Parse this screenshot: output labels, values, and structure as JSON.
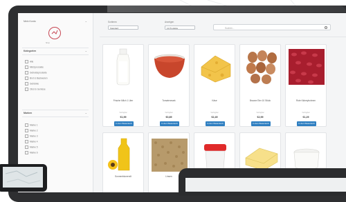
{
  "sidebar": {
    "account_label": "Mein Konto",
    "logo_caption": "Shop",
    "categories_title": "Kategorien",
    "categories": [
      "Alle",
      "Milchprodukte",
      "Getreideprodukte",
      "Brot & Backwaren",
      "Getränke",
      "Obst & Gemüse"
    ],
    "brands_title": "Marken",
    "brands": [
      "Marke 1",
      "Marke 2",
      "Marke 3",
      "Marke 4",
      "Marke 5",
      "Marke 6"
    ]
  },
  "toolbar": {
    "sort_label": "Sortieren",
    "sort_value": "Standard",
    "show_label": "Anzeigen",
    "show_value": "12 Produkte",
    "search_placeholder": "Suchen..."
  },
  "products": [
    {
      "name": "Frische Milch 1 Liter",
      "meta": "Verfügbar",
      "price": "€1,99",
      "button": "In den Warenkorb"
    },
    {
      "name": "Tomatenmark",
      "meta": "Verfügbar",
      "price": "€0,89",
      "button": "In den Warenkorb"
    },
    {
      "name": "Käse",
      "meta": "Verfügbar",
      "price": "€2,49",
      "button": "In den Warenkorb"
    },
    {
      "name": "Braune Eier 10 Stück",
      "meta": "Verfügbar",
      "price": "€2,99",
      "button": "In den Warenkorb"
    },
    {
      "name": "Rote Kidneybohnen",
      "meta": "Verfügbar",
      "price": "€1,29",
      "button": "In den Warenkorb"
    },
    {
      "name": "Sonnenblumenöl",
      "meta": "",
      "price": "",
      "button": ""
    },
    {
      "name": "Linsen",
      "meta": "",
      "price": "",
      "button": ""
    },
    {
      "name": "",
      "meta": "",
      "price": "",
      "button": ""
    },
    {
      "name": "",
      "meta": "",
      "price": "",
      "button": ""
    },
    {
      "name": "",
      "meta": "",
      "price": "",
      "button": ""
    }
  ],
  "colors": {
    "accent": "#2f7fc1",
    "frame": "#2e2f31",
    "logo": "#c64552"
  }
}
